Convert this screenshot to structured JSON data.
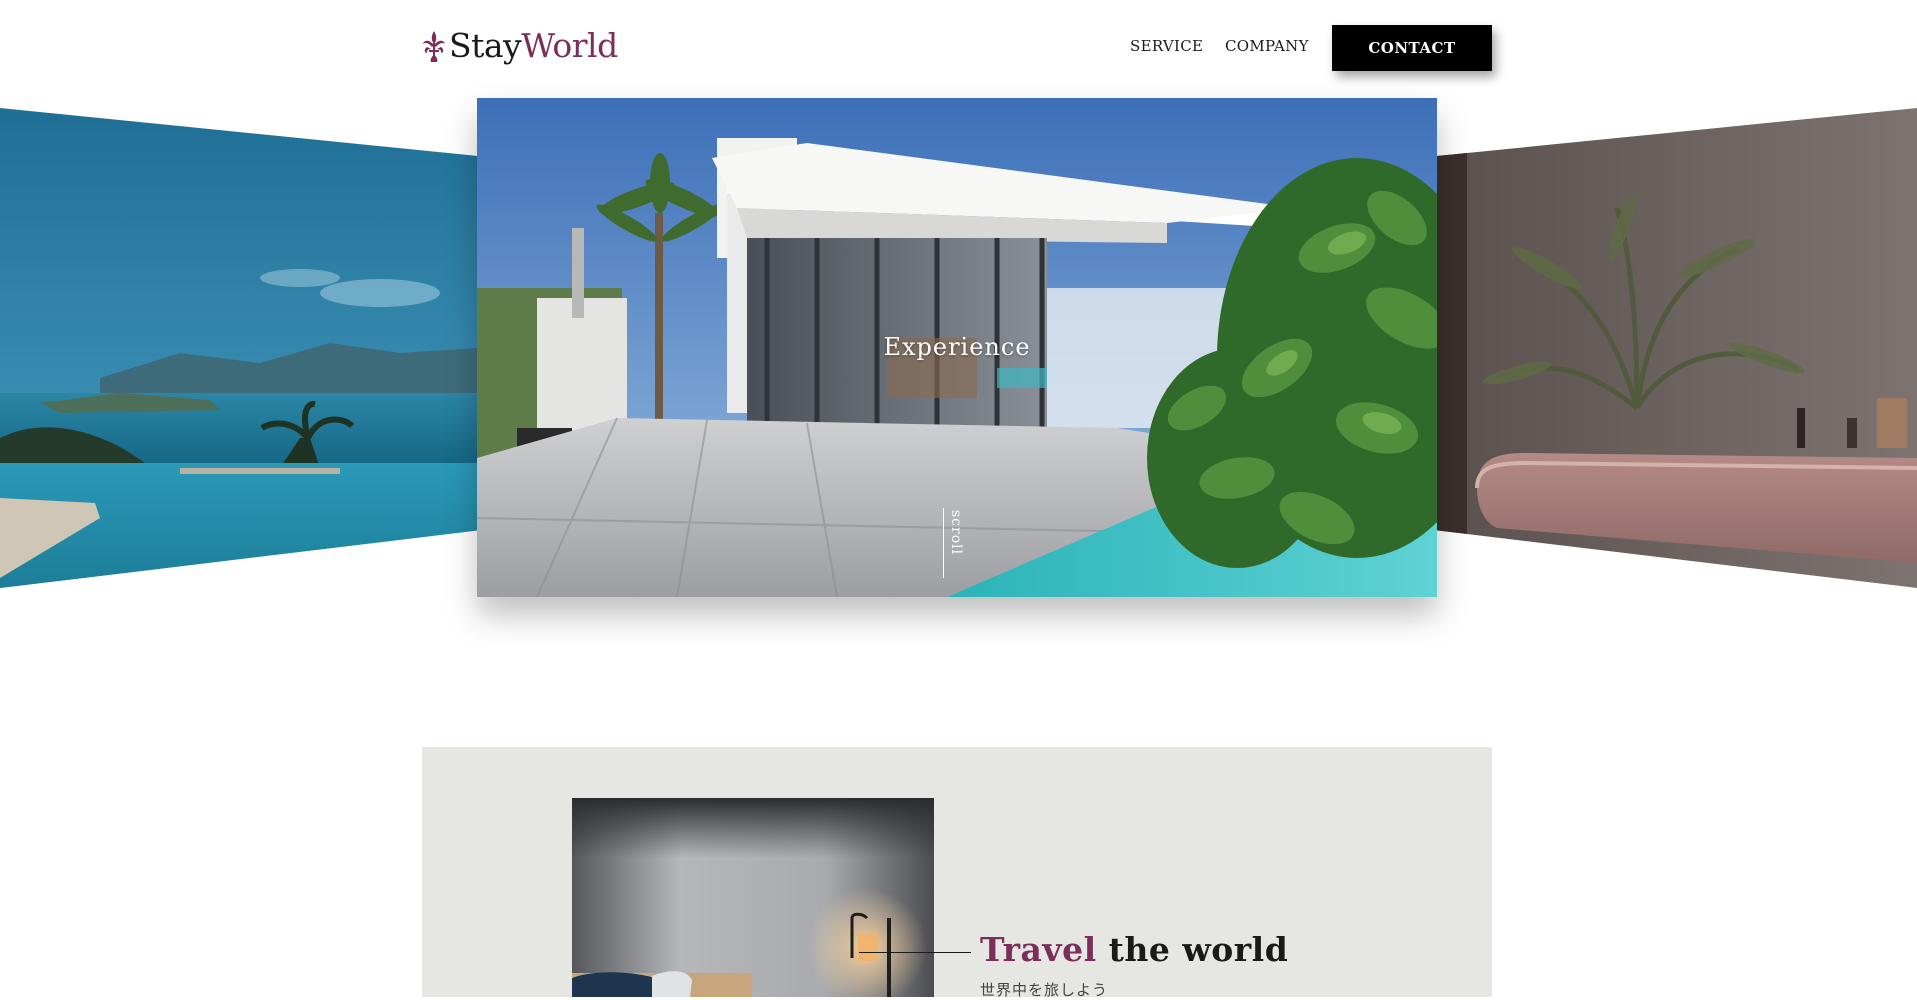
{
  "header": {
    "logo": {
      "text_main": "Stay",
      "text_accent": "World",
      "icon": "fleur-icon"
    },
    "nav": [
      {
        "label": "SERVICE"
      },
      {
        "label": "COMPANY"
      }
    ],
    "contact_label": "CONTACT"
  },
  "hero": {
    "title": "Experience",
    "scroll_label": "scroll",
    "slides": [
      "infinity-pool-sea-photo",
      "modern-villa-photo",
      "bathtub-palm-photo"
    ]
  },
  "about": {
    "heading_accent": "Travel",
    "heading_rest": "the world",
    "subheading": "世界中を旅しよう",
    "photo": "bedroom-lamp-photo"
  },
  "colors": {
    "accent": "#7c2e5a",
    "contact_bg": "#000000",
    "section_bg": "#e6e6e2"
  }
}
